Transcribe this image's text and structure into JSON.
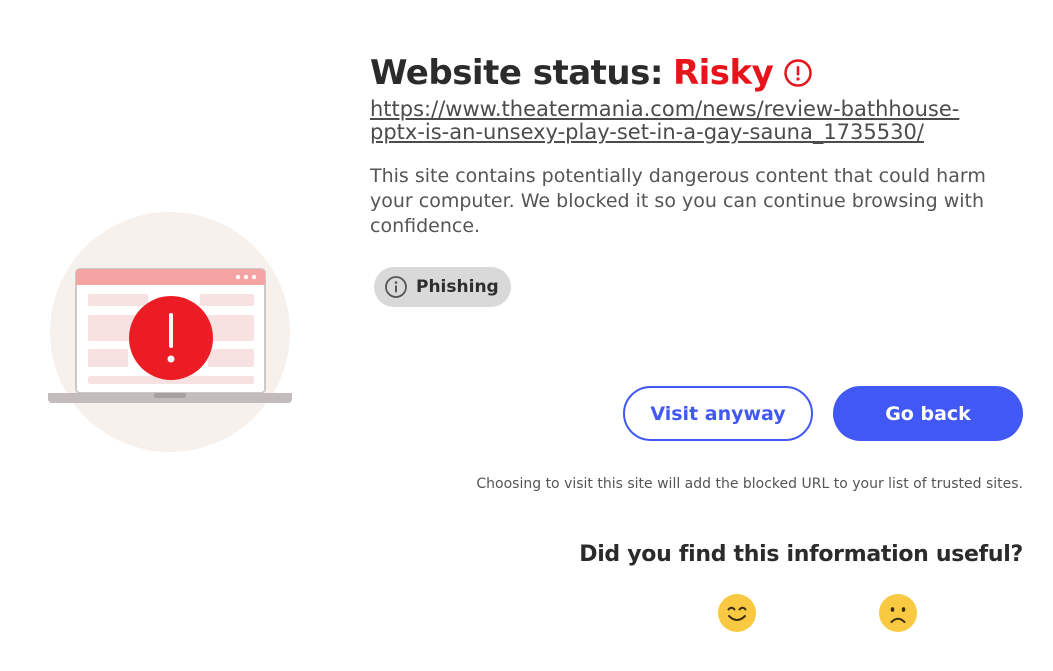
{
  "header": {
    "status_label": "Website status:",
    "status_value": "Risky"
  },
  "blocked_url": "https://www.theatermania.com/news/review-bathhouse-pptx-is-an-unsexy-play-set-in-a-gay-sauna_1735530/",
  "description": "This site contains potentially dangerous content that could harm your computer. We blocked it so you can continue browsing with confidence.",
  "threat": {
    "label": "Phishing",
    "icon": "info-icon"
  },
  "actions": {
    "visit_label": "Visit anyway",
    "back_label": "Go back"
  },
  "visit_note": "Choosing to visit this site will add the blocked URL to your list of trusted sites.",
  "feedback": {
    "question": "Did you find this information useful?",
    "positive_icon": "smiley-face-icon",
    "negative_icon": "sad-face-icon"
  },
  "colors": {
    "risk_red": "#e8141c",
    "accent_blue": "#4158f5",
    "emoji_yellow": "#f9c942"
  }
}
